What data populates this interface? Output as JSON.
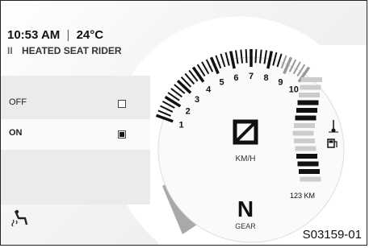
{
  "status": {
    "time": "10:53 AM",
    "separator": "|",
    "temperature": "24°C"
  },
  "menu": {
    "title": "HEATED SEAT RIDER",
    "pause_symbol": "II",
    "options": [
      {
        "label": "OFF",
        "selected": false
      },
      {
        "label": "ON",
        "selected": true
      }
    ]
  },
  "gauge": {
    "scale_labels": [
      "1",
      "2",
      "3",
      "4",
      "5",
      "6",
      "7",
      "8",
      "9",
      "10"
    ],
    "speed_unit": "KM/H",
    "speed_value_symbol": "⌀",
    "gear_value": "N",
    "gear_label": "GEAR",
    "fuel_range": "123 KM"
  },
  "caption": "S03159-01",
  "icons": {
    "seat": "heated-seat-icon",
    "temperature": "coolant-temperature-icon",
    "fuel": "fuel-pump-icon"
  },
  "colors": {
    "gauge_gray": "#9a9a9a",
    "tick_dark": "#111111",
    "redline": "#bbbbbb"
  }
}
